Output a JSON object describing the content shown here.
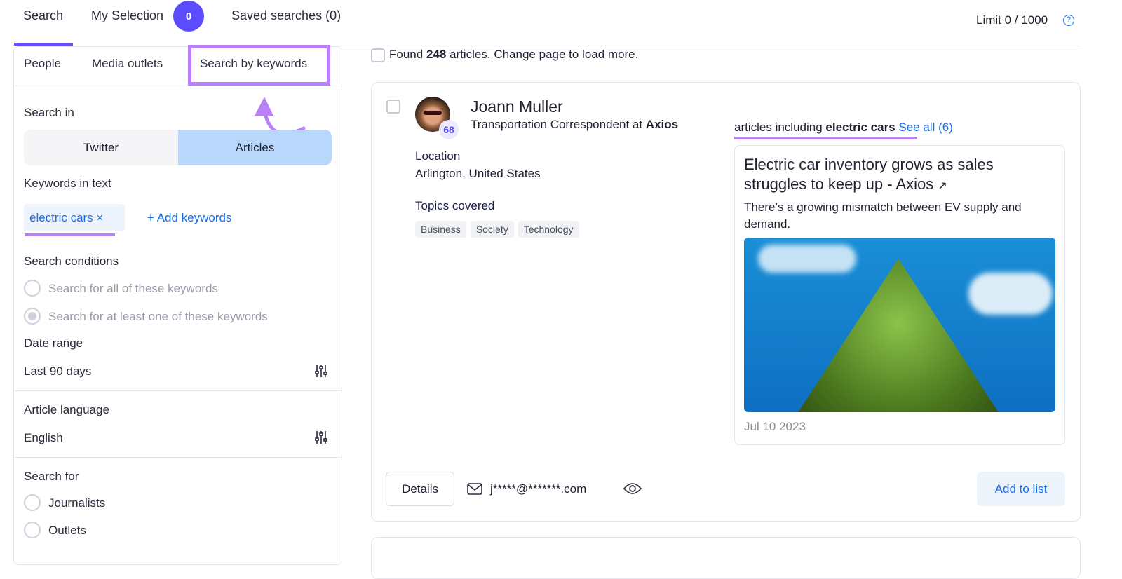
{
  "top_tabs": {
    "search": "Search",
    "my_selection": "My Selection",
    "selection_count": "0",
    "saved": "Saved searches (0)"
  },
  "limit": "Limit 0 / 1000",
  "sub_tabs": [
    "People",
    "Media outlets",
    "Search by keywords"
  ],
  "filters": {
    "search_in_label": "Search in",
    "search_in_options": [
      "Twitter",
      "Articles"
    ],
    "search_in_selected": "Articles",
    "keywords_label": "Keywords in text",
    "keyword_chip": "electric cars",
    "add_keywords": "+ Add keywords",
    "conditions_label": "Search conditions",
    "conditions": [
      "Search for all of these keywords",
      "Search for at least one of these keywords"
    ],
    "conditions_selected": 1,
    "date_label": "Date range",
    "date_value": "Last 90 days",
    "language_label": "Article language",
    "language_value": "English",
    "search_for_label": "Search for",
    "search_for": [
      "Journalists",
      "Outlets"
    ]
  },
  "results": {
    "found_prefix": "Found ",
    "found_count": "248",
    "found_suffix": " articles. Change page to load more."
  },
  "card": {
    "name": "Joann Muller",
    "score": "68",
    "title_prefix": "Transportation Correspondent at ",
    "outlet": "Axios",
    "location_label": "Location",
    "location": "Arlington, United States",
    "topics_label": "Topics covered",
    "topics": [
      "Business",
      "Society",
      "Technology"
    ],
    "articles_prefix": "articles including ",
    "articles_keyword": "electric cars",
    "see_all": "See all (6)",
    "article": {
      "title": "Electric car inventory grows as sales struggles to keep up - Axios",
      "desc": "There’s a growing mismatch between EV supply and demand.",
      "date": "Jul 10 2023"
    },
    "details": "Details",
    "email": "j*****@*******.com",
    "add_to_list": "Add to list"
  },
  "colors": {
    "accent": "#6450ff",
    "highlight": "#b980f7",
    "link": "#1a6ee8",
    "selected_seg": "#b9d7fb"
  }
}
